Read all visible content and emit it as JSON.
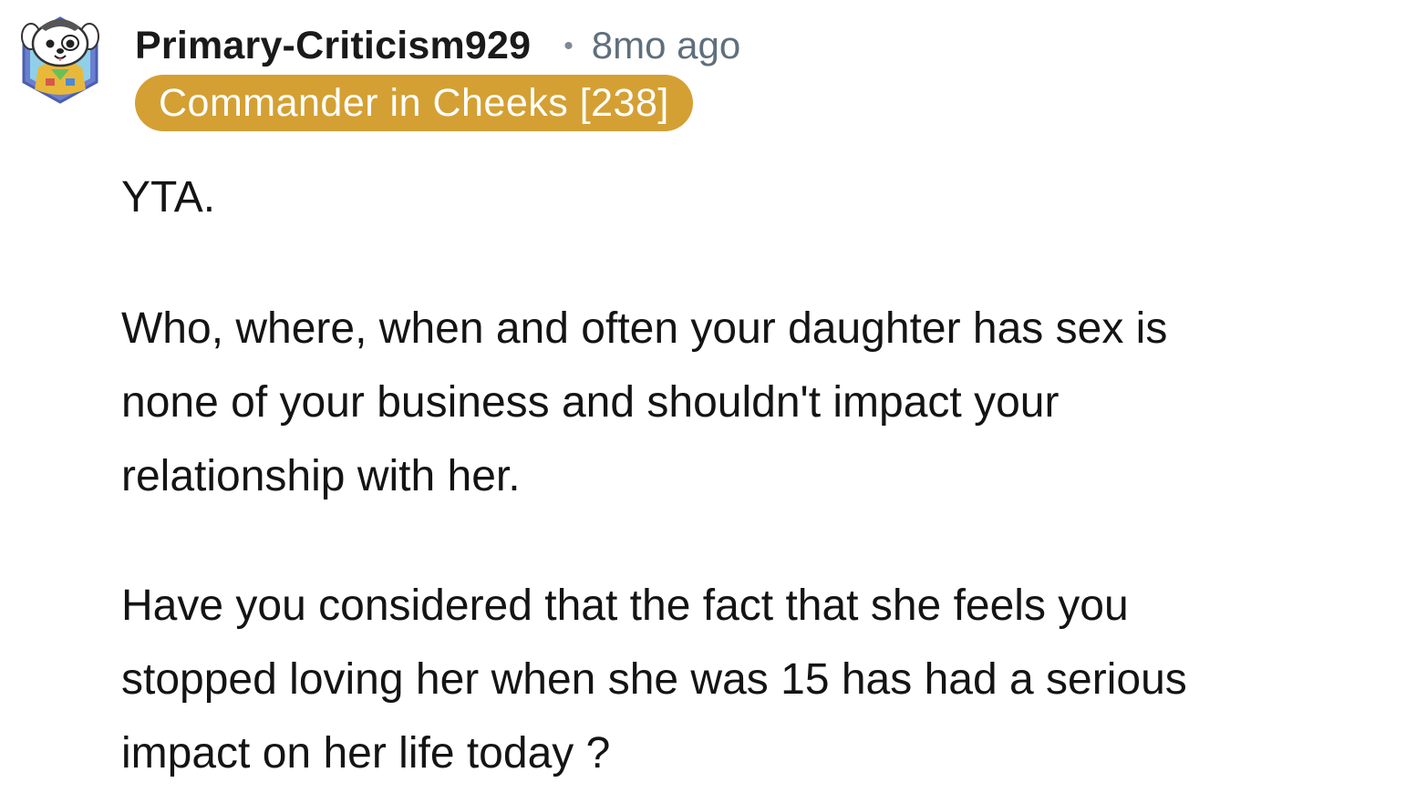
{
  "comment": {
    "avatar_icon": "snoo-avatar-icon",
    "username": "Primary-Criticism929",
    "separator": "•",
    "timestamp": "8mo ago",
    "flair": "Commander in Cheeks [238]",
    "flair_color": "#d4a033",
    "body_lines": [
      "YTA.",
      "Who, where, when and often your daughter has sex is",
      "none of your business and shouldn't impact your",
      "relationship with her.",
      "Have you considered that the fact that she feels you",
      "stopped loving her when she was 15 has had a serious",
      "impact on her life today ?"
    ]
  }
}
